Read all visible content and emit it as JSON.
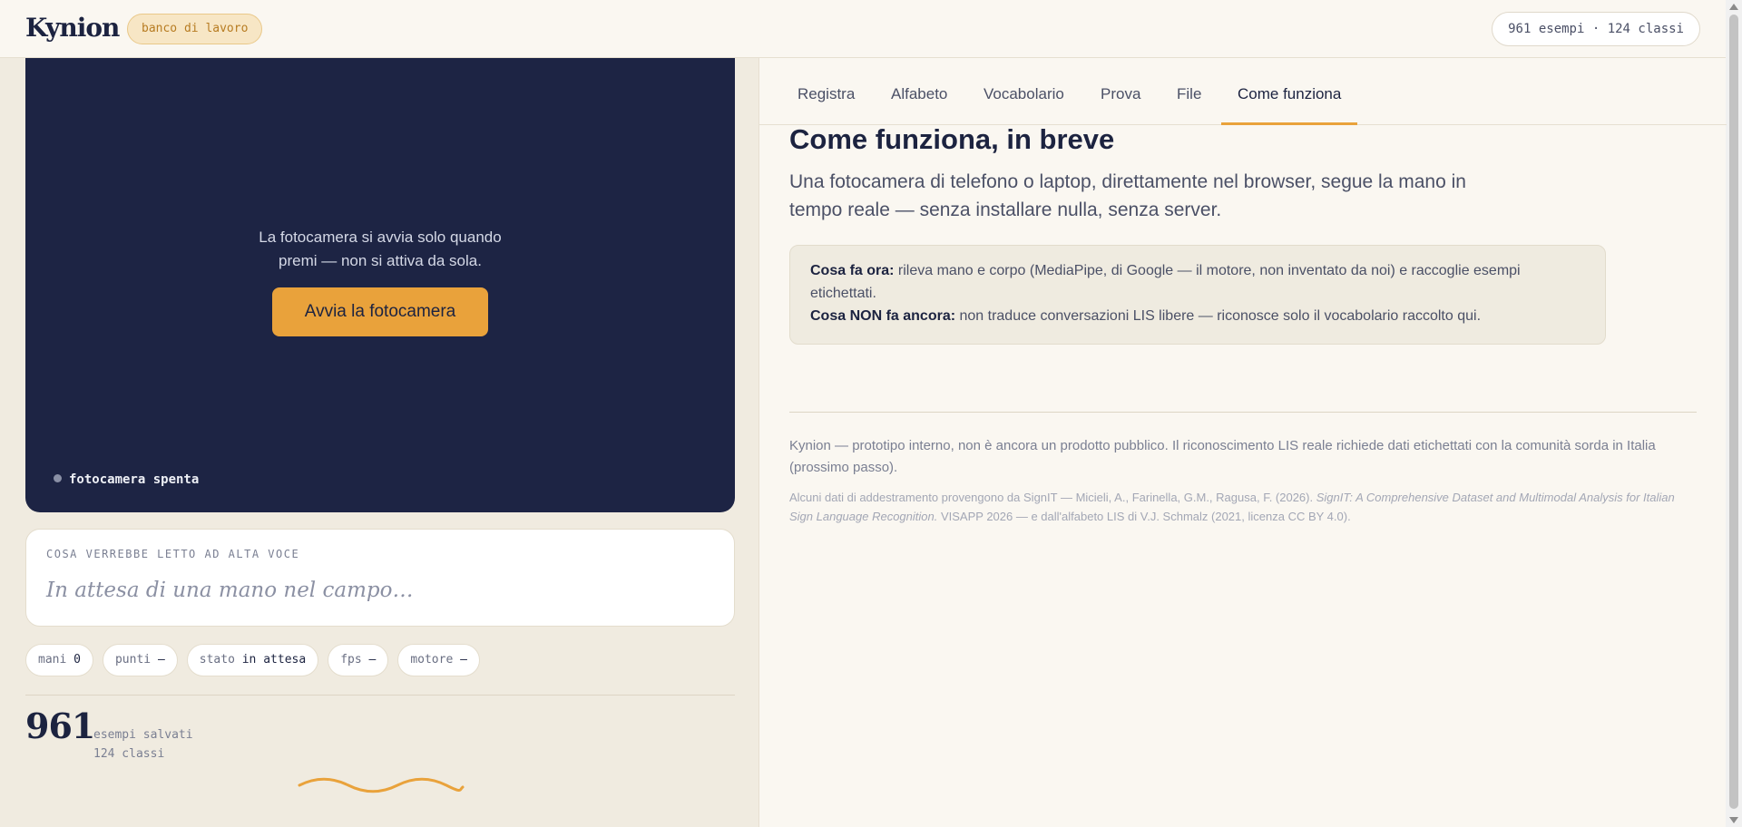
{
  "header": {
    "brand": "Kynion",
    "badge": "banco di lavoro",
    "stats": "961 esempi · 124 classi"
  },
  "camera": {
    "message_line1": "La fotocamera si avvia solo quando",
    "message_line2": "premi — non si attiva da sola.",
    "start_button": "Avvia la fotocamera",
    "status": "fotocamera spenta"
  },
  "speech": {
    "label": "COSA VERREBBE LETTO AD ALTA VOCE",
    "placeholder": "In attesa di una mano nel campo…"
  },
  "chips": [
    {
      "label": "mani",
      "value": "0"
    },
    {
      "label": "punti",
      "value": "—"
    },
    {
      "label": "stato",
      "value": "in attesa"
    },
    {
      "label": "fps",
      "value": "—"
    },
    {
      "label": "motore",
      "value": "—"
    }
  ],
  "counter": {
    "value": "961",
    "line1": "esempi salvati",
    "line2": "124 classi"
  },
  "tabs": [
    {
      "label": "Registra"
    },
    {
      "label": "Alfabeto"
    },
    {
      "label": "Vocabolario"
    },
    {
      "label": "Prova"
    },
    {
      "label": "File"
    },
    {
      "label": "Come funziona",
      "active": true
    }
  ],
  "content": {
    "title": "Come funziona, in breve",
    "lead": "Una fotocamera di telefono o laptop, direttamente nel browser, segue la mano in tempo reale — senza installare nulla, senza server.",
    "now_label": "Cosa fa ora:",
    "now_text": " rileva mano e corpo (MediaPipe, di Google — il motore, non inventato da noi) e raccoglie esempi etichettati.",
    "not_label": "Cosa NON fa ancora:",
    "not_text": " non traduce conversazioni LIS libere — riconosce solo il vocabolario raccolto qui.",
    "footer1": "Kynion — prototipo interno, non è ancora un prodotto pubblico. Il riconoscimento LIS reale richiede dati etichettati con la comunità sorda in Italia (prossimo passo).",
    "footer2_a": "Alcuni dati di addestramento provengono da SignIT — Micieli, A., Farinella, G.M., Ragusa, F. (2026). ",
    "footer2_em": "SignIT: A Comprehensive Dataset and Multimodal Analysis for Italian Sign Language Recognition.",
    "footer2_b": " VISAPP 2026 — e dall'alfabeto LIS di V.J. Schmalz (2021, licenza CC BY 4.0)."
  },
  "colors": {
    "accent": "#e9a23b",
    "navy": "#1d2444",
    "background": "#f0ebe0",
    "panel": "#faf7f1"
  },
  "icons": {
    "camera_status": "status-dot-icon",
    "decoration": "wave-icon"
  }
}
